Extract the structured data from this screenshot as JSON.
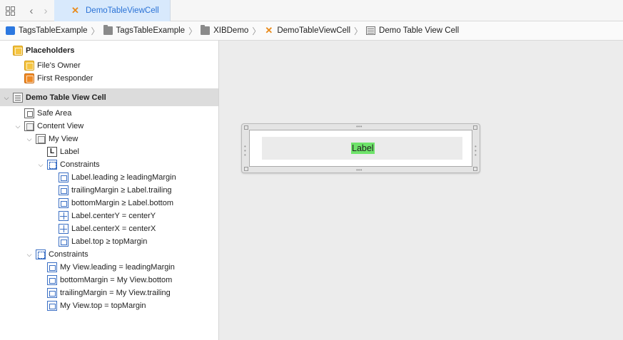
{
  "tabbar": {
    "active_tab": "DemoTableViewCell",
    "icons": {
      "grid": "grid-icon",
      "back": "chevron-left-icon",
      "forward": "chevron-right-icon",
      "tab": "swift-file-icon"
    }
  },
  "breadcrumb": {
    "items": [
      "TagsTableExample",
      "TagsTableExample",
      "XIBDemo",
      "DemoTableViewCell",
      "Demo Table View Cell"
    ],
    "icons": [
      "xcode-project-icon",
      "folder-icon",
      "folder-icon",
      "swift-file-icon",
      "table-view-cell-icon"
    ]
  },
  "outline": {
    "placeholders": {
      "title": "Placeholders",
      "items": [
        "File's Owner",
        "First Responder"
      ]
    },
    "cell": {
      "title": "Demo Table View Cell",
      "safe_area": "Safe Area",
      "content_view": "Content View",
      "my_view": "My View",
      "label": "Label",
      "inner_constraints_title": "Constraints",
      "inner_constraints": [
        "Label.leading ≥ leadingMargin",
        "trailingMargin ≥ Label.trailing",
        "bottomMargin ≥ Label.bottom",
        "Label.centerY = centerY",
        "Label.centerX = centerX",
        "Label.top ≥ topMargin"
      ],
      "outer_constraints_title": "Constraints",
      "outer_constraints": [
        "My View.leading = leadingMargin",
        "bottomMargin = My View.bottom",
        "trailingMargin = My View.trailing",
        "My View.top = topMargin"
      ]
    }
  },
  "canvas": {
    "label_text": "Label",
    "label_highlight_color": "#6ee36a",
    "my_view_color": "#ebebeb"
  }
}
